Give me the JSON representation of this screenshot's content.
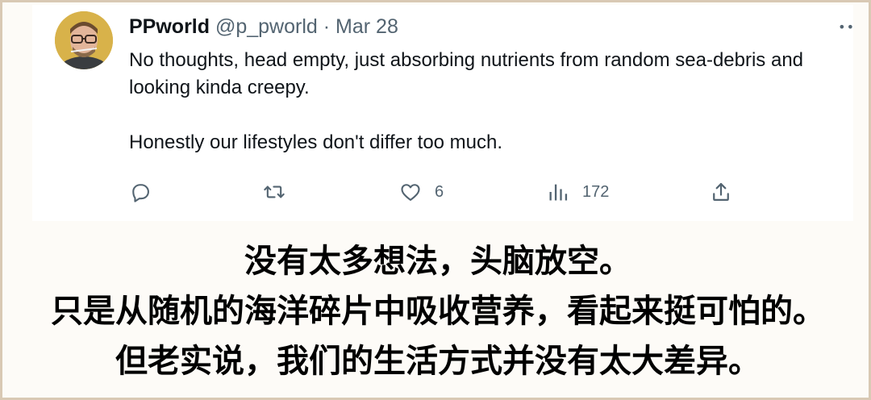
{
  "tweet": {
    "author_name": "PPworld",
    "handle": "@p_pworld",
    "separator": "·",
    "date": "Mar 28",
    "more_glyph": "••",
    "text_line_1": "No thoughts, head empty, just absorbing nutrients from random sea-debris and looking kinda creepy.",
    "text_line_2": "Honestly our lifestyles don't differ too much.",
    "actions": {
      "reply_icon": "reply-icon",
      "retweet_icon": "retweet-icon",
      "like_icon": "heart-icon",
      "like_count": "6",
      "views_icon": "views-icon",
      "views_count": "172",
      "share_icon": "share-icon"
    }
  },
  "caption": {
    "line_1": "没有太多想法，头脑放空。",
    "line_2": "只是从随机的海洋碎片中吸收营养，看起来挺可怕的。",
    "line_3": "但老实说，我们的生活方式并没有太大差异。"
  },
  "colors": {
    "text_primary": "#0f1419",
    "text_secondary": "#536471",
    "frame_border": "#d9c9b4",
    "avatar_bg": "#d8b24a"
  }
}
